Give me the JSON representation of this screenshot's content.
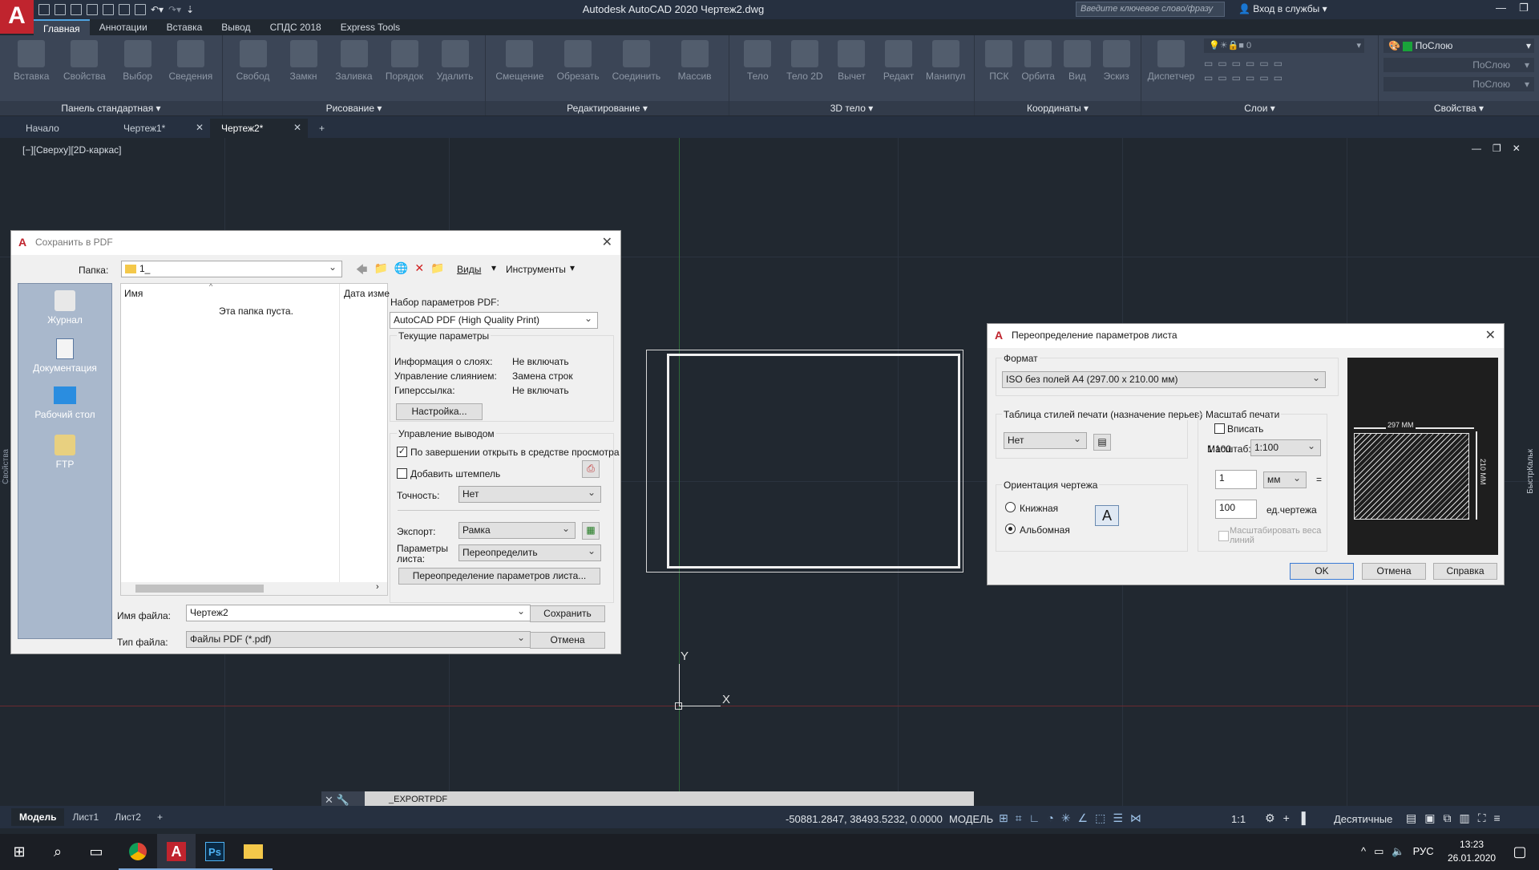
{
  "app": {
    "title": "Autodesk AutoCAD 2020   Чертеж2.dwg",
    "logo": "A",
    "search_placeholder": "Введите ключевое слово/фразу",
    "signin": "Вход в службы"
  },
  "ribbon_tabs": [
    "Главная",
    "Аннотации",
    "Вставка",
    "Вывод",
    "СПДС 2018",
    "Express Tools"
  ],
  "panels": [
    {
      "title": "Панель стандартная ▾",
      "buttons": [
        "Вставка",
        "Свойства",
        "Выбор",
        "Сведения"
      ]
    },
    {
      "title": "Рисование ▾",
      "buttons": [
        "Свобод",
        "Замкн",
        "Заливка",
        "Порядок",
        "Удалить"
      ]
    },
    {
      "title": "Редактирование ▾",
      "buttons": [
        "Смещение",
        "Обрезать",
        "Соединить",
        "Массив"
      ]
    },
    {
      "title": "3D тело ▾",
      "buttons": [
        "Тело",
        "Тело 2D",
        "Вычет",
        "Редакт",
        "Манипул"
      ]
    },
    {
      "title": "Координаты ▾",
      "buttons": [
        "ПСК",
        "Орбита",
        "Вид",
        "Эскиз"
      ]
    },
    {
      "title": "Слои ▾",
      "buttons": [
        "Диспетчер"
      ]
    },
    {
      "title": "Свойства ▾",
      "buttons": []
    }
  ],
  "properties": {
    "layer": "ПоСлою",
    "color": "ПоСлою",
    "linetype": "ПоСлою",
    "zero": "0"
  },
  "doc_tabs": [
    "Начало",
    "Чертеж1*",
    "Чертеж2*"
  ],
  "viewport_label": "[−][Сверху][2D-каркас]",
  "side_labels": {
    "left": "Свойства",
    "right": "БыстрКальк"
  },
  "save_dialog": {
    "title": "Сохранить в PDF",
    "folder_label": "Папка:",
    "folder_value": "1_",
    "views": "Виды",
    "tools": "Инструменты",
    "places": [
      "Журнал",
      "Документация",
      "Рабочий стол",
      "FTP"
    ],
    "col_name": "Имя",
    "col_date": "Дата изме",
    "empty": "Эта папка пуста.",
    "preset_label": "Набор параметров PDF:",
    "preset_value": "AutoCAD PDF (High Quality Print)",
    "current_title": "Текущие параметры",
    "params": [
      {
        "k": "Информация о слоях:",
        "v": "Не включать"
      },
      {
        "k": "Управление слиянием:",
        "v": "Замена строк"
      },
      {
        "k": "Гиперссылка:",
        "v": "Не включать"
      }
    ],
    "settings_btn": "Настройка...",
    "output_title": "Управление выводом",
    "open_after": "По завершении открыть в средстве просмотра",
    "add_stamp": "Добавить штемпель",
    "precision_label": "Точность:",
    "precision_value": "Нет",
    "export_label": "Экспорт:",
    "export_value": "Рамка",
    "page_label": "Параметры листа:",
    "page_value": "Переопределить",
    "override_btn": "Переопределение параметров листа...",
    "filename_label": "Имя файла:",
    "filename_value": "Чертеж2",
    "filetype_label": "Тип файла:",
    "filetype_value": "Файлы PDF (*.pdf)",
    "save_btn": "Сохранить",
    "cancel_btn": "Отмена"
  },
  "override_dialog": {
    "title": "Переопределение параметров листа",
    "format_label": "Формат",
    "format_value": "ISO без полей A4 (297.00 x 210.00 мм)",
    "plotstyle_label": "Таблица стилей печати (назначение перьев)",
    "plotstyle_value": "Нет",
    "scale_title": "Масштаб печати",
    "fit": "Вписать",
    "scale_label": "Масштаб:",
    "scale_value": "1:100",
    "mm_value": "1",
    "unit_value": "мм",
    "units_value": "100",
    "units_label": "ед.чертежа",
    "scale_lw": "Масштабировать веса линий",
    "orient_title": "Ориентация чертежа",
    "portrait": "Книжная",
    "landscape": "Альбомная",
    "dim_w": "297 MM",
    "dim_h": "210 MM",
    "ok": "OK",
    "cancel": "Отмена",
    "help": "Справка"
  },
  "axes": {
    "x": "X",
    "y": "Y"
  },
  "command": "_EXPORTPDF",
  "layout_tabs": [
    "Модель",
    "Лист1",
    "Лист2"
  ],
  "status": {
    "coords": "-50881.2847, 38493.5232, 0.0000",
    "mode": "МОДЕЛЬ",
    "scale": "1:1",
    "units": "Десятичные"
  },
  "taskbar": {
    "lang": "РУС",
    "time": "13:23",
    "date": "26.01.2020"
  }
}
